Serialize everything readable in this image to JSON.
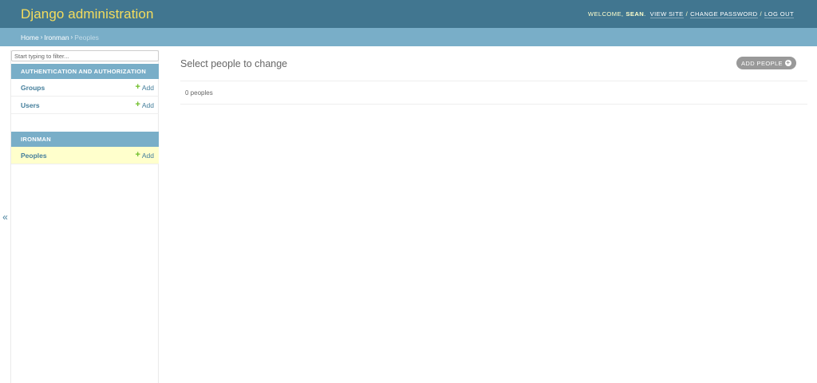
{
  "header": {
    "site_name": "Django administration",
    "welcome": "Welcome,",
    "username": "Sean",
    "view_site": "View site",
    "change_password": "Change password",
    "log_out": "Log out",
    "separator": "/"
  },
  "breadcrumbs": {
    "home": "Home",
    "app": "Ironman",
    "current": "Peoples",
    "arrow": "›"
  },
  "sidebar": {
    "toggle_label": "«",
    "filter_placeholder": "Start typing to filter...",
    "modules": [
      {
        "caption": "Authentication and Authorization",
        "models": [
          {
            "name": "Groups",
            "add_label": "Add"
          },
          {
            "name": "Users",
            "add_label": "Add"
          }
        ]
      },
      {
        "caption": "Ironman",
        "models": [
          {
            "name": "Peoples",
            "add_label": "Add",
            "current": true
          }
        ]
      }
    ],
    "plus_glyph": "+"
  },
  "content": {
    "title": "Select people to change",
    "add_button_label": "Add People",
    "add_button_glyph": "+",
    "paginator_text": "0 peoples"
  },
  "colors": {
    "header_bg": "#417690",
    "site_name": "#f5dd5d",
    "breadcrumbs_bg": "#79aec8",
    "link": "#447e9b",
    "add_icon": "#70bf2b",
    "current_row_bg": "#ffffcc"
  }
}
